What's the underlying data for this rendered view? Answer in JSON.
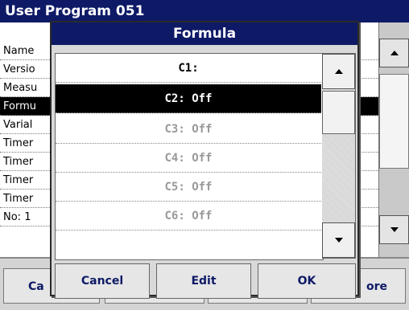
{
  "background": {
    "title": "User Program    051",
    "rows": [
      {
        "label": "Name"
      },
      {
        "label": "Versio"
      },
      {
        "label": "Measu"
      },
      {
        "label": "Formu"
      },
      {
        "label": "Varial"
      },
      {
        "label": "Timer"
      },
      {
        "label": "Timer"
      },
      {
        "label": "Timer"
      },
      {
        "label": "Timer"
      },
      {
        "label": "No: 1"
      }
    ],
    "bottom_buttons": {
      "left": "Ca",
      "right": "ore"
    }
  },
  "dialog": {
    "title": "Formula",
    "items": [
      {
        "label": "C1:"
      },
      {
        "label": "C2: Off"
      },
      {
        "label": "C3: Off"
      },
      {
        "label": "C4: Off"
      },
      {
        "label": "C5: Off"
      },
      {
        "label": "C6: Off"
      }
    ],
    "buttons": {
      "cancel": "Cancel",
      "edit": "Edit",
      "ok": "OK"
    }
  },
  "icons": {
    "up": "arrow-up-icon",
    "down": "arrow-down-icon"
  },
  "colors": {
    "title_bar": "#0e1a66",
    "selection": "#000000",
    "button_text": "#0e1a66"
  }
}
